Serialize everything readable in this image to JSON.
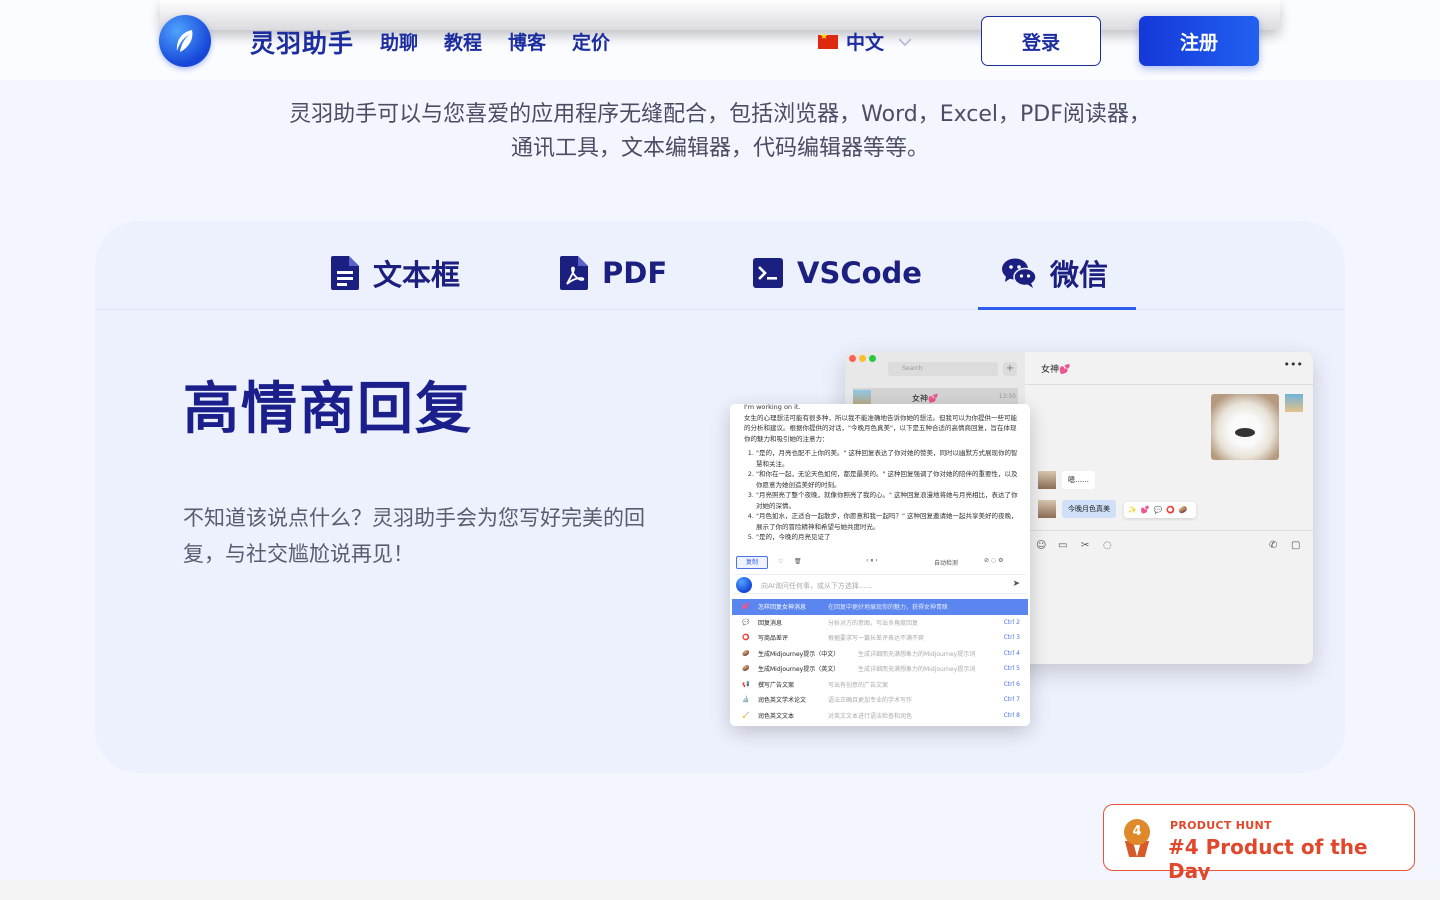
{
  "header": {
    "brand": "灵羽助手",
    "nav": [
      "助聊",
      "教程",
      "博客",
      "定价"
    ],
    "language": "中文",
    "login_label": "登录",
    "signup_label": "注册",
    "accent_color": "#1c2da0",
    "signup_color": "#1538d9"
  },
  "intro": {
    "text": "灵羽助手可以与您喜爱的应用程序无缝配合，包括浏览器，Word，Excel，PDF阅读器，通讯工具，文本编辑器，代码编辑器等等。"
  },
  "tabs": [
    {
      "label": "文本框",
      "icon": "document-icon"
    },
    {
      "label": "PDF",
      "icon": "pdf-icon"
    },
    {
      "label": "VSCode",
      "icon": "terminal-icon"
    },
    {
      "label": "微信",
      "icon": "wechat-icon",
      "active": true
    }
  ],
  "feature": {
    "title": "高情商回复",
    "description": "不知道该说点什么？灵羽助手会为您写好完美的回复，与社交尴尬说再见！"
  },
  "screenshot": {
    "wechat": {
      "search_placeholder": "Search",
      "contact_name": "女神💕",
      "contact_time": "13:50",
      "chat_title": "女神💕",
      "messages": [
        "嗯……",
        "今晚月色真美"
      ],
      "reactions": [
        "✨",
        "💕",
        "💬",
        "⭕",
        "🥔"
      ]
    },
    "ai_panel": {
      "top_line": "I'm working on it.",
      "intro": "女生的心理想法可能有很多种，所以我不能准确地告诉你她的想法。但我可以为你提供一些可能的分析和建议。根据你提供的对话，\"今晚月色真美\"，以下是五种合适的高情商回复，旨在体现你的魅力和吸引她的注意力：",
      "replies": [
        "\"是的，月亮也配不上你的美。\" 这种回复表达了你对她的赞美，同时以幽默方式展现你的智慧和关注。",
        "\"和你在一起，无论天色如何，都是最美的。\" 这种回复强调了你对她的陪伴的重要性，以及你愿意为她创造美好的时刻。",
        "\"月亮照亮了整个夜晚，就像你照亮了我的心。\" 这种回复浪漫地将她与月亮相比，表达了你对她的深情。",
        "\"月色如水，正适合一起散步，你愿意和我一起吗？\" 这种回复邀请她一起共享美好的夜晚，展示了你的冒险精神和希望与她共度时光。",
        "\"是的，今晚的月亮见证了"
      ],
      "copy_label": "复制",
      "auto_detect": "自动检测",
      "input_placeholder": "向AI询问任何事，或从下方选择……",
      "menu": [
        {
          "icon": "💕",
          "name": "怎样回复女神消息",
          "desc": "在回复中更好地展现你的魅力，获得女神青睐",
          "shortcut": "",
          "active": true
        },
        {
          "icon": "💬",
          "name": "回复消息",
          "desc": "分析对方的意图，写出多角度回复",
          "shortcut": "Ctrl 2"
        },
        {
          "icon": "⭕",
          "name": "写商品差评",
          "desc": "根据要求写一篇长差评表达不满不爽",
          "shortcut": "Ctrl 3"
        },
        {
          "icon": "🥔",
          "name": "生成Midjourney提示（中文）",
          "desc": "生成详细而充满想象力的Midjourney提示词",
          "shortcut": "Ctrl 4"
        },
        {
          "icon": "🥔",
          "name": "生成Midjourney提示（英文）",
          "desc": "生成详细而充满想象力的Midjourney提示词",
          "shortcut": "Ctrl 5"
        },
        {
          "icon": "📢",
          "name": "撰写广告文案",
          "desc": "写出有创意的广告文案",
          "shortcut": "Ctrl 6"
        },
        {
          "icon": "🔬",
          "name": "润色英文学术论文",
          "desc": "语法正确且更加专业的学术写作",
          "shortcut": "Ctrl 7"
        },
        {
          "icon": "🧹",
          "name": "润色英文文本",
          "desc": "对英文文本进行语法检查和润色",
          "shortcut": "Ctrl 8"
        }
      ]
    }
  },
  "product_hunt": {
    "label": "PRODUCT HUNT",
    "rank_text": "#4 Product of the Day",
    "medal_number": "4",
    "color": "#e0472b"
  }
}
